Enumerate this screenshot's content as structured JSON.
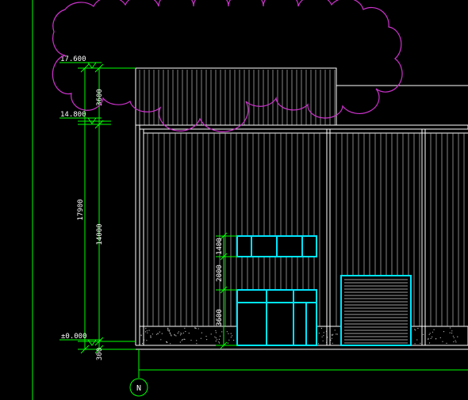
{
  "colors": {
    "background": "#000000",
    "dimension": "#00ff00",
    "building": "#ffffff",
    "cladding": "#c8c8c8",
    "openings": "#00e5ff",
    "revision_cloud": "#cc33cc",
    "ground_hatch": "#bfbfbf"
  },
  "levels": {
    "top": "17.600",
    "eave": "14.800",
    "ground": "±0.000"
  },
  "dimensions": {
    "overall": "17900",
    "roof_segment": "3600",
    "wall_segment": "14000",
    "base_segment": "300",
    "window_height": "1400",
    "mid_wall": "2000",
    "door_height": "3600"
  },
  "grid_axis": {
    "label": "N"
  }
}
